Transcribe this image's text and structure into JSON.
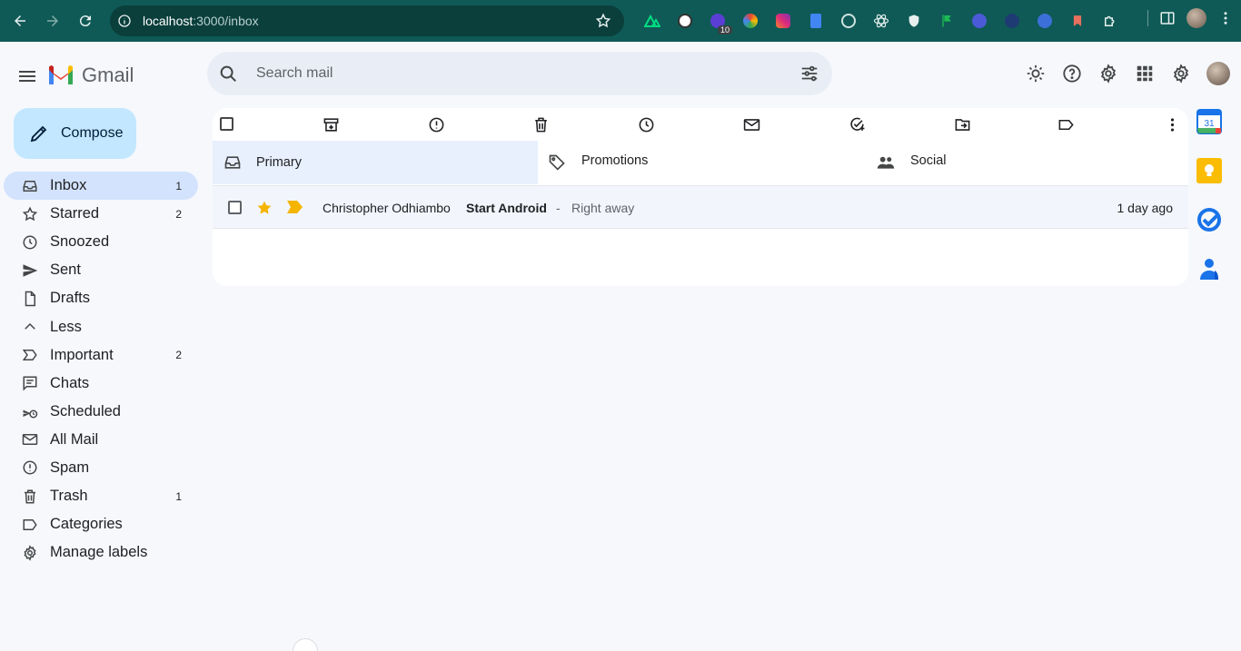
{
  "browser": {
    "url_host": "localhost",
    "url_path": ":3000/inbox",
    "extension_badge": "10"
  },
  "app": {
    "brand": "Gmail"
  },
  "search": {
    "placeholder": "Search mail"
  },
  "compose": {
    "label": "Compose"
  },
  "sidebar": {
    "items": [
      {
        "label": "Inbox",
        "count": "1",
        "icon": "inbox-icon"
      },
      {
        "label": "Starred",
        "count": "2",
        "icon": "star-icon"
      },
      {
        "label": "Snoozed",
        "count": "",
        "icon": "clock-icon"
      },
      {
        "label": "Sent",
        "count": "",
        "icon": "send-icon"
      },
      {
        "label": "Drafts",
        "count": "",
        "icon": "draft-icon"
      },
      {
        "label": "Less",
        "count": "",
        "icon": "chevron-up-icon"
      },
      {
        "label": "Important",
        "count": "2",
        "icon": "important-icon"
      },
      {
        "label": "Chats",
        "count": "",
        "icon": "chat-icon"
      },
      {
        "label": "Scheduled",
        "count": "",
        "icon": "scheduled-icon"
      },
      {
        "label": "All Mail",
        "count": "",
        "icon": "all-mail-icon"
      },
      {
        "label": "Spam",
        "count": "",
        "icon": "spam-icon"
      },
      {
        "label": "Trash",
        "count": "1",
        "icon": "trash-icon"
      },
      {
        "label": "Categories",
        "count": "",
        "icon": "label-icon"
      },
      {
        "label": "Manage labels",
        "count": "",
        "icon": "gear-icon"
      }
    ]
  },
  "tabs": [
    {
      "label": "Primary"
    },
    {
      "label": "Promotions"
    },
    {
      "label": "Social"
    }
  ],
  "mail": {
    "rows": [
      {
        "sender": "Christopher Odhiambo",
        "subject": "Start Android",
        "separator": "-",
        "snippet": "Right away",
        "date": "1 day ago",
        "starred": true,
        "important": true
      }
    ]
  },
  "colors": {
    "chrome_bg": "#0f5a56",
    "compose_bg": "#c2e7ff",
    "active_nav": "#d3e3fd",
    "star": "#f4b400",
    "important": "#f4b400"
  }
}
